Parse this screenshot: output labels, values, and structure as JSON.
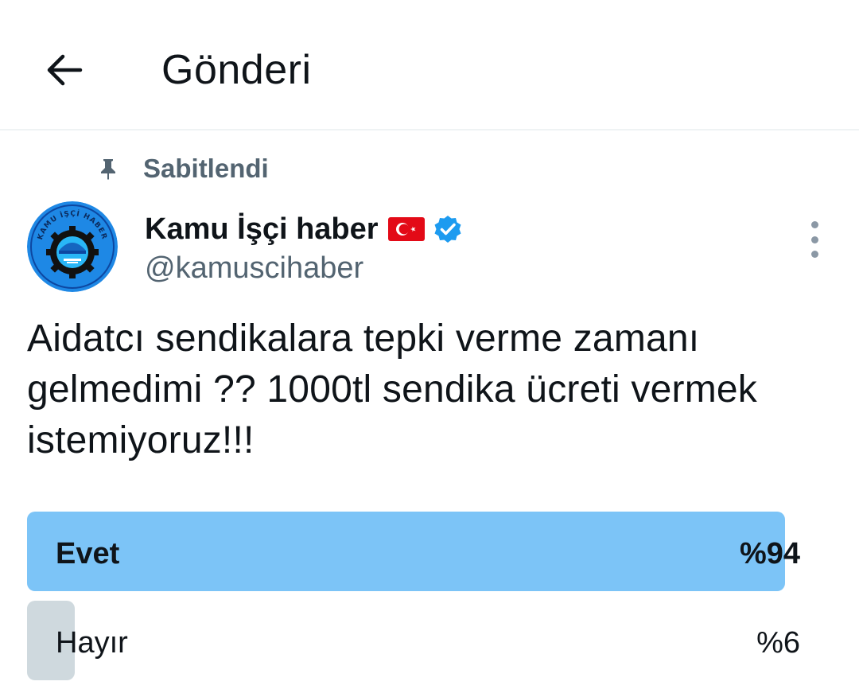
{
  "header": {
    "title": "Gönderi",
    "back_icon": "arrow-left-icon"
  },
  "pinned": {
    "label": "Sabitlendi",
    "icon": "pin-icon"
  },
  "author": {
    "name": "Kamu İşçi haber",
    "handle": "@kamuscihaber",
    "flag_icon": "turkey-flag-icon",
    "verified_icon": "verified-badge-icon",
    "avatar_text": "KAMU İŞÇİ HABER"
  },
  "tweet": {
    "text": "Aidatcı sendikalara tepki verme zamanı\ngelmedimi ?? 1000tl sendika ücreti vermek\nistemiyoruz!!!"
  },
  "poll": {
    "options": [
      {
        "label": "Evet",
        "percent_text": "%94",
        "percent": 94,
        "winner": true,
        "color": "#7cc4f7"
      },
      {
        "label": "Hayır",
        "percent_text": "%6",
        "percent": 6,
        "winner": false,
        "color": "#cfd9de"
      }
    ]
  },
  "colors": {
    "accent": "#1d9bf0",
    "secondary_text": "#536471",
    "divider": "#eff3f4"
  }
}
